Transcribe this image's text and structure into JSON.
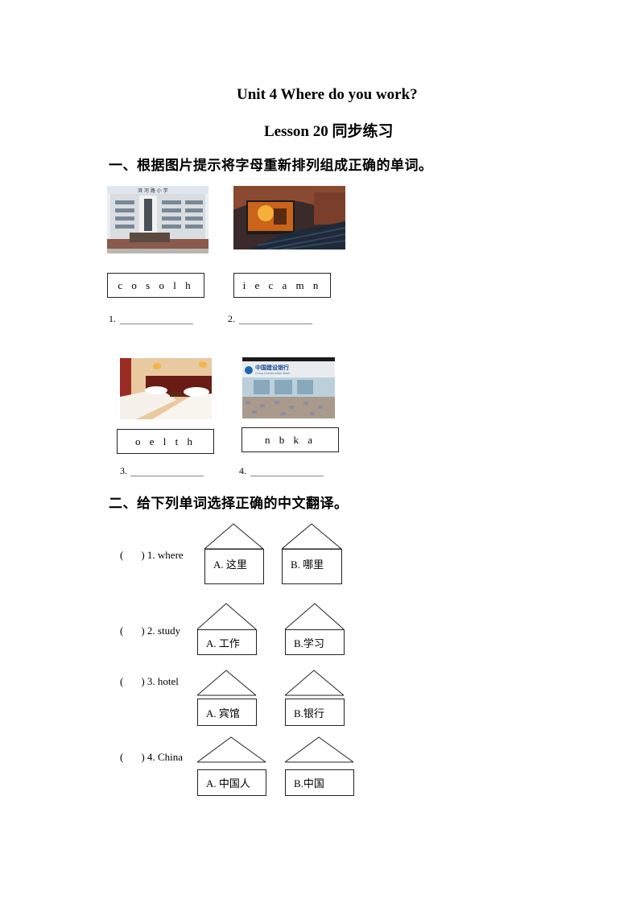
{
  "header": {
    "title": "Unit 4 Where do you work?",
    "subtitle": "Lesson 20  同步练习"
  },
  "section1": {
    "heading": "一、根据图片提示将字母重新排列组成正确的单词。",
    "items": [
      {
        "number": "1.",
        "picture": "school-building-photo",
        "letters": "c o s o l h",
        "blank": "______________"
      },
      {
        "number": "2.",
        "picture": "cinema-hall-photo",
        "letters": "i e c a m n",
        "blank": "______________"
      },
      {
        "number": "3.",
        "picture": "hotel-room-photo",
        "letters": "o e l t h",
        "blank": "______________"
      },
      {
        "number": "4.",
        "picture": "bank-front-photo",
        "letters": "n b k a",
        "blank": "______________"
      }
    ]
  },
  "section2": {
    "heading": "二、给下列单词选择正确的中文翻译。",
    "questions": [
      {
        "prefix": "(",
        "suffix": ") 1. where",
        "options": [
          "A.  这里",
          "B.  哪里"
        ]
      },
      {
        "prefix": "(",
        "suffix": ") 2. study",
        "options": [
          "A.  工作",
          "B.学习"
        ]
      },
      {
        "prefix": "(",
        "suffix": ") 3. hotel",
        "options": [
          "A.  宾馆",
          "B.银行"
        ]
      },
      {
        "prefix": "(",
        "suffix": ") 4. China",
        "options": [
          "A.  中国人",
          "B.中国"
        ]
      }
    ]
  }
}
